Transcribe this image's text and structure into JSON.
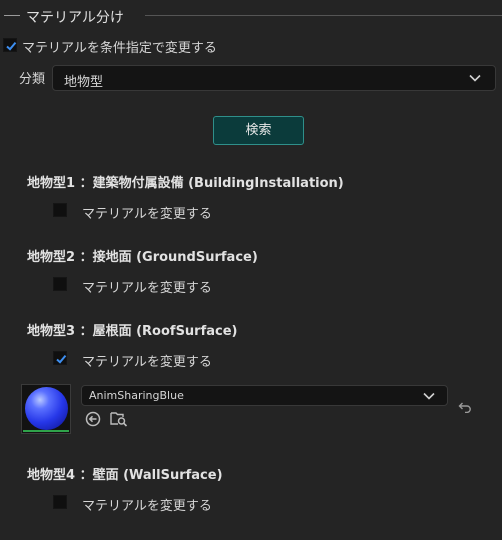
{
  "section": {
    "title": "マテリアル分け"
  },
  "change_by_condition": {
    "label": "マテリアルを条件指定で変更する",
    "checked": true
  },
  "classification": {
    "label": "分類",
    "value": "地物型"
  },
  "search_button": {
    "label": "検索"
  },
  "categories": [
    {
      "title": "地物型1 ：建築物付属設備 (BuildingInstallation)",
      "change_label": "マテリアルを変更する",
      "checked": false
    },
    {
      "title": "地物型2 ：接地面 (GroundSurface)",
      "change_label": "マテリアルを変更する",
      "checked": false
    },
    {
      "title": "地物型3 ：屋根面 (RoofSurface)",
      "change_label": "マテリアルを変更する",
      "checked": true
    },
    {
      "title": "地物型4 ：壁面 (WallSurface)",
      "change_label": "マテリアルを変更する",
      "checked": false
    }
  ],
  "material": {
    "value": "AnimSharingBlue"
  },
  "colors": {
    "accent": "#2f8f8a",
    "check": "#3d8ef0"
  }
}
